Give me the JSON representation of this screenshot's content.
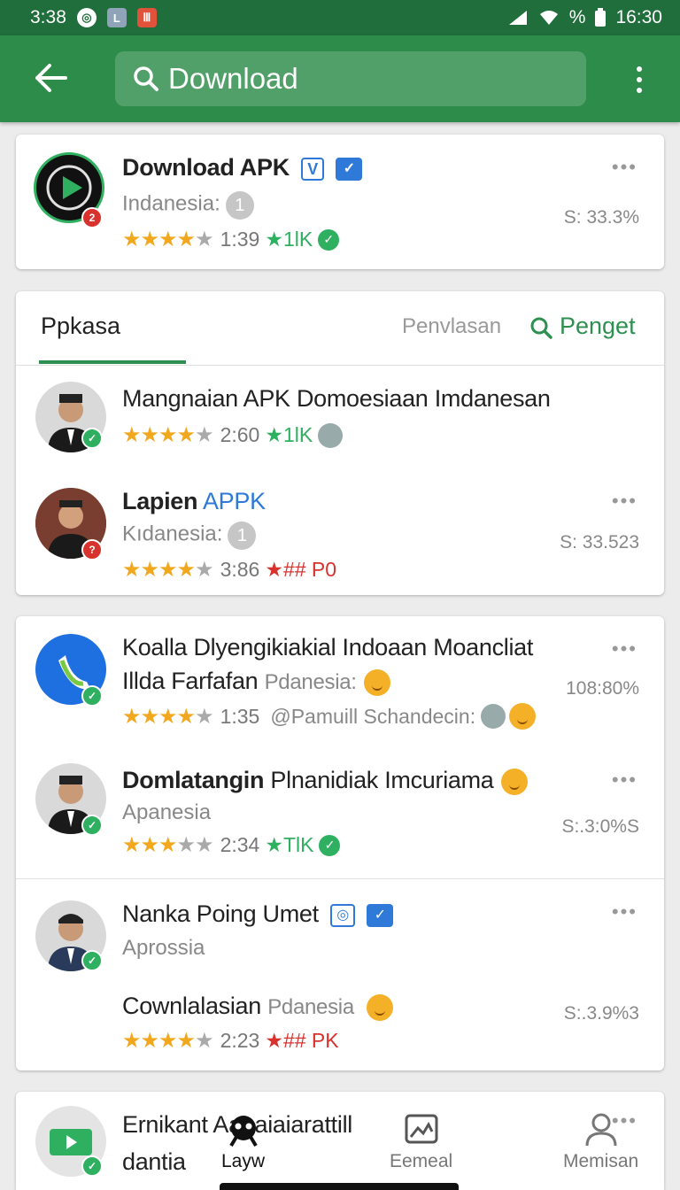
{
  "status_bar": {
    "time_left": "3:38",
    "battery_pct": "%",
    "time_right": "16:30"
  },
  "app_bar": {
    "search_value": "Download"
  },
  "featured": {
    "title": "Download APK",
    "badge_count": "2",
    "subtitle": "Indanesia:",
    "subtitle_num": "1",
    "stars": 4,
    "rating_time": "1:39",
    "rating_count": "★1lK",
    "percent": "S: 33.3%"
  },
  "tabs": {
    "active": "Ppkasa",
    "second": "Penvlasan",
    "third": "Penget"
  },
  "list_a": [
    {
      "title": "Mangnaian APK Domoesiaan  Imdanesan",
      "stars": 4,
      "rating_time": "2:60",
      "rating_count": "★1lK"
    },
    {
      "title_bold": "Lapien",
      "title_blue": "APPK",
      "subtitle": "Kıdanesia:",
      "subtitle_num": "1",
      "stars": 4,
      "rating_time": "3:86",
      "rating_count": "★## P0",
      "percent": "S: 33.523"
    }
  ],
  "list_b": [
    {
      "title": "Koalla Dlyengikiakial Indoaan Moancliat",
      "title2": "Illda Farfafan",
      "title2_grey": "Pdanesia:",
      "stars": 4,
      "rating_time": "1:35",
      "rating_extra": "@Pamuill Schandecin:",
      "percent": "108:80%"
    },
    {
      "title_bold": "Domlatangin",
      "title_rest": "Plnanidiak Imcuriama",
      "subtitle": "Apanesia",
      "stars": 3,
      "rating_time": "2:34",
      "rating_count": "★TlK",
      "percent": "S:.3:0%S"
    },
    {
      "title": "Nanka Poing Umet",
      "subtitle": "Aprossia",
      "line3": "Cownlalasian",
      "line3_grey": "Pdanesia",
      "stars": 4,
      "rating_time": "2:23",
      "rating_count": "★## PK",
      "percent": "S:.3.9%3"
    }
  ],
  "partial_item": {
    "title": "Ernikant A",
    "title_tail": "anaiaiarattill",
    "line2": "dantia"
  },
  "bottom_nav": [
    {
      "label": "Layw"
    },
    {
      "label": "Eemeal"
    },
    {
      "label": "Memisan"
    }
  ],
  "colors": {
    "primary": "#2d8c49",
    "status": "#1f6e3b",
    "accent": "#2fb060",
    "star": "#f2a81e"
  }
}
